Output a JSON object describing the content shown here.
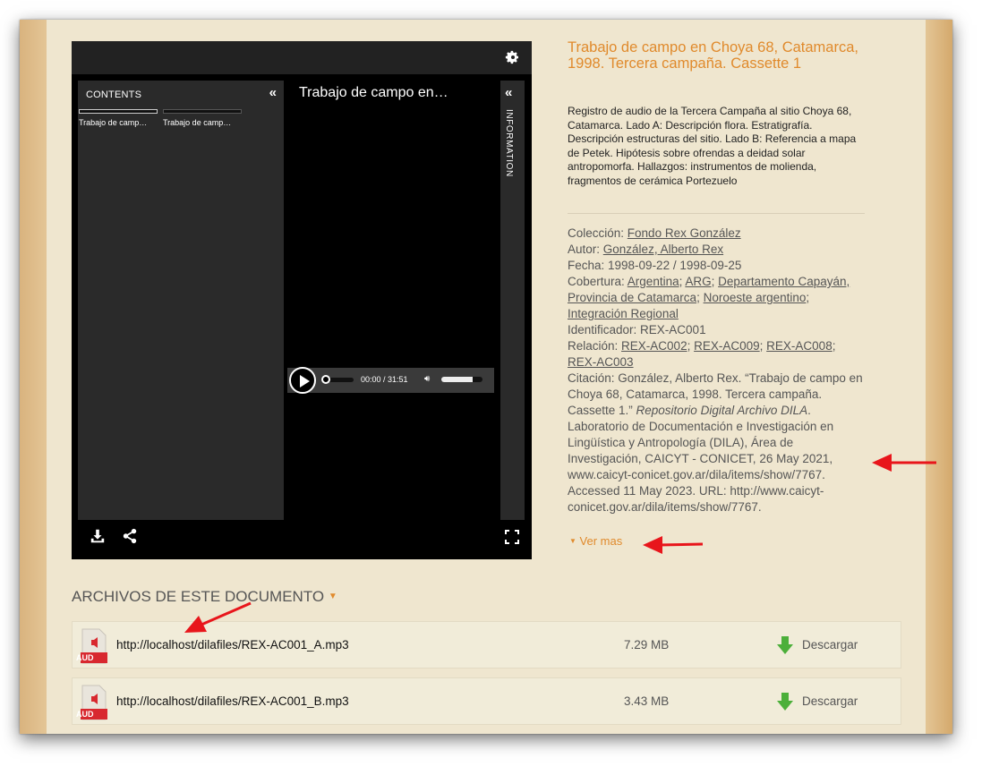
{
  "viewer": {
    "contents_label": "CONTENTS",
    "collapse_glyph": "«",
    "thumb_1_label": "Trabajo de camp…",
    "thumb_2_label": "Trabajo de camp…",
    "center_title": "Trabajo de campo en…",
    "info_label": "INFORMATION",
    "player": {
      "time": "00:00 / 31:51",
      "volume_level": 0.75,
      "progress": 0.0
    },
    "icons": [
      "gear-icon",
      "download-icon",
      "share-icon",
      "fullscreen-icon",
      "play-icon",
      "volume-icon"
    ]
  },
  "document": {
    "title": "Trabajo de campo en Choya 68, Catamarca, 1998. Tercera campaña. Cassette 1",
    "description": "Registro de audio de la Tercera Campaña al sitio Choya 68, Catamarca. Lado A: Descripción flora. Estratigrafía. Descripción estructuras del sitio. Lado B: Referencia a mapa de Petek. Hipótesis sobre ofrendas a deidad solar antropomorfa. Hallazgos: instrumentos de molienda, fragmentos de cerámica Portezuelo"
  },
  "meta": {
    "coleccion_label": "Colección: ",
    "coleccion": "Fondo Rex González",
    "autor_label": "Autor: ",
    "autor": "González, Alberto Rex",
    "fecha": "Fecha: 1998-09-22 / 1998-09-25",
    "cobertura_label": "Cobertura: ",
    "cobertura": [
      "Argentina",
      "ARG",
      "Departamento Capayán, Provincia de Catamarca",
      "Noroeste argentino",
      "Integración Regional"
    ],
    "identificador": "Identificador: REX-AC001",
    "relacion_label": "Relación: ",
    "relacion": [
      "REX-AC002",
      "REX-AC009",
      "REX-AC008",
      "REX-AC003"
    ],
    "citacion_label": "Citación: ",
    "citacion_a": "González, Alberto Rex. “Trabajo de campo en Choya 68, Catamarca, 1998. Tercera campaña. Cassette 1.” ",
    "citacion_italic": "Repositorio Digital Archivo DILA",
    "citacion_b": ". Laboratorio de Documentación e Investigación en Lingüística y Antropología (DILA), Área de Investigación, CAICYT - CONICET, 26 May 2021, www.caicyt-conicet.gov.ar/dila/items/show/7767. Accessed 11 May 2023. URL: http://www.caicyt-conicet.gov.ar/dila/items/show/7767.",
    "sep": "; ",
    "ver_mas": "Ver mas",
    "ver_mas_glyph": "▼"
  },
  "files": {
    "title": "ARCHIVOS DE ESTE DOCUMENTO",
    "title_glyph": "▼",
    "badge": "AUD",
    "download_label": "Descargar",
    "items": [
      {
        "url": "http://localhost/dilafiles/REX-AC001_A.mp3",
        "size": "7.29 MB"
      },
      {
        "url": "http://localhost/dilafiles/REX-AC001_B.mp3",
        "size": "3.43 MB"
      }
    ]
  },
  "colors": {
    "accent": "#e08a2c",
    "page_bg": "#efe6cf",
    "frame": "#d9b37e",
    "annotation_arrow": "#e8151b",
    "download_green": "#4caf3a"
  }
}
